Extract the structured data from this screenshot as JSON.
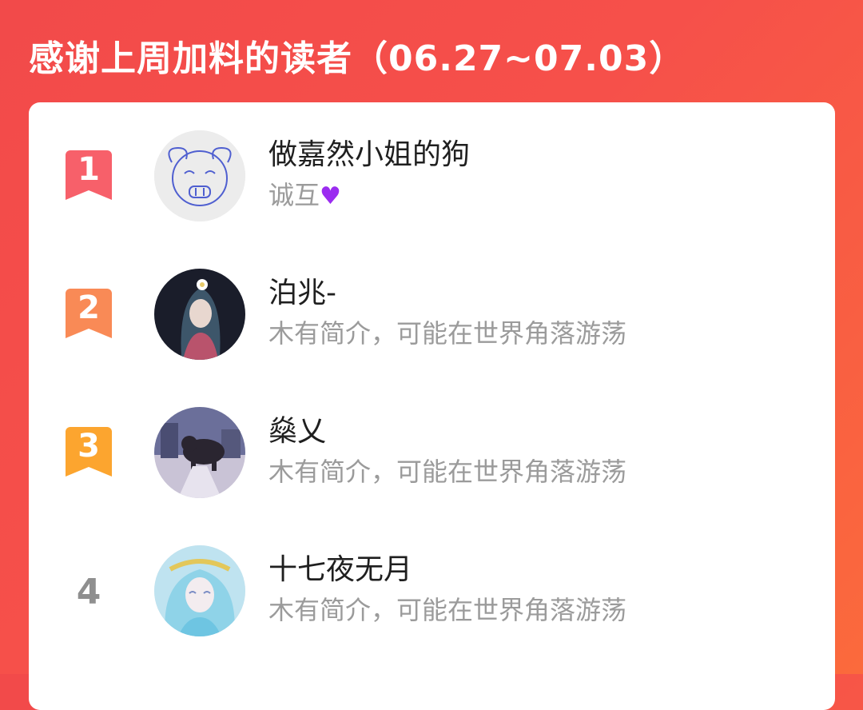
{
  "header": {
    "title": "感谢上周加料的读者（06.27~07.03）"
  },
  "colors": {
    "rank1": "#f7606a",
    "rank2": "#f98a56",
    "rank3": "#fca52f",
    "rank_plain": "#8f8f8f",
    "heart": "#9b2cf0"
  },
  "readers": [
    {
      "rank": "1",
      "name": "做嘉然小姐的狗",
      "desc": "诚互",
      "desc_icon": "purple-heart-icon",
      "avatar": "doodle-face-avatar"
    },
    {
      "rank": "2",
      "name": "泊兆-",
      "desc": "木有简介，可能在世界角落游荡",
      "avatar": "anime-girl-flower-avatar"
    },
    {
      "rank": "3",
      "name": "燊乂",
      "desc": "木有简介，可能在世界角落游荡",
      "avatar": "cat-street-photo-avatar"
    },
    {
      "rank": "4",
      "name": "十七夜无月",
      "desc": "木有简介，可能在世界角落游荡",
      "avatar": "anime-blue-hair-avatar"
    }
  ]
}
